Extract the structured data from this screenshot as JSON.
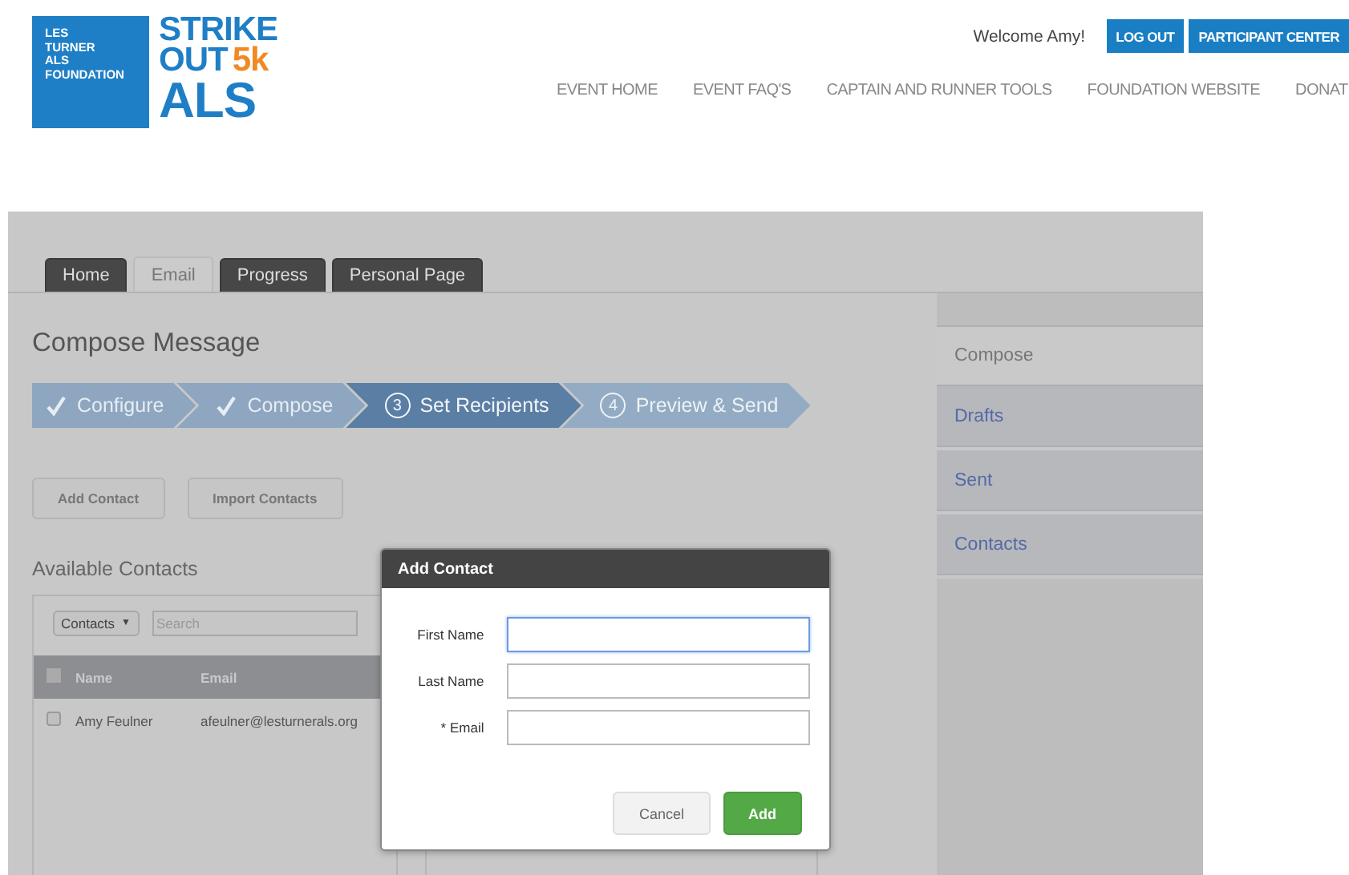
{
  "logo": {
    "foundation_lines": [
      "LES",
      "TURNER",
      "ALS",
      "FOUNDATION"
    ],
    "event_lines": [
      {
        "text": "STRIKE"
      },
      {
        "text": "OUT",
        "accent": "5k"
      },
      {
        "text": "ALS"
      }
    ]
  },
  "account": {
    "welcome": "Welcome Amy!",
    "buttons": [
      "LOG OUT",
      "PARTICIPANT CENTER"
    ]
  },
  "nav": [
    "EVENT HOME",
    "EVENT FAQ'S",
    "CAPTAIN AND RUNNER TOOLS",
    "FOUNDATION WEBSITE",
    "DONAT"
  ],
  "tabs": [
    {
      "label": "Home",
      "selected": false
    },
    {
      "label": "Email",
      "selected": true
    },
    {
      "label": "Progress",
      "selected": false
    },
    {
      "label": "Personal Page",
      "selected": false
    }
  ],
  "title": "Compose Message",
  "steps": [
    {
      "label": "Configure",
      "done": true,
      "selected": false
    },
    {
      "label": "Compose",
      "done": true,
      "selected": false
    },
    {
      "label": "Set Recipients",
      "done": false,
      "selected": true,
      "number": "3"
    },
    {
      "label": "Preview & Send",
      "done": false,
      "selected": false,
      "number": "4"
    }
  ],
  "actions": [
    "Add Contact",
    "Import Contacts"
  ],
  "contacts": {
    "heading": "Available Contacts",
    "filter": "Contacts",
    "filter_caret": "▼",
    "all_checked": false,
    "search_placeholder": "Search",
    "columns": [
      "Name",
      "Email"
    ],
    "rows": [
      {
        "name": "Amy Feulner",
        "email": "afeulner@lesturnerals.org",
        "checked": false
      }
    ]
  },
  "sidebar": [
    {
      "label": "Compose",
      "selected": true
    },
    {
      "label": "Drafts",
      "selected": false
    },
    {
      "label": "Sent",
      "selected": false
    },
    {
      "label": "Contacts",
      "selected": false
    }
  ],
  "dialog": {
    "title": "Add Contact",
    "fields": [
      {
        "label": "First Name",
        "focused": true
      },
      {
        "label": "Last Name",
        "focused": false
      },
      {
        "label": "* Email",
        "focused": false
      }
    ],
    "buttons": [
      {
        "label": "Cancel",
        "kind": "secondary"
      },
      {
        "label": "Add",
        "kind": "primary"
      }
    ]
  }
}
